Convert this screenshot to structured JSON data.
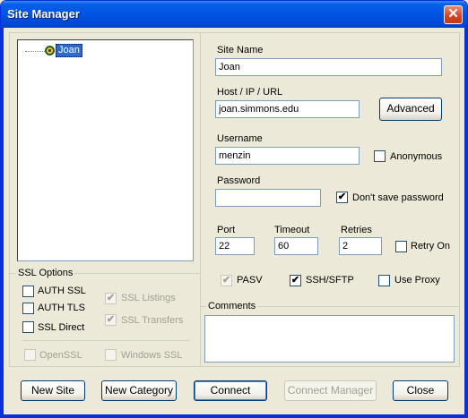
{
  "window": {
    "title": "Site Manager"
  },
  "tree": {
    "items": [
      {
        "label": "Joan"
      }
    ]
  },
  "ssl_options": {
    "label": "SSL Options",
    "auth_ssl": {
      "label": "AUTH SSL",
      "checked": false
    },
    "auth_tls": {
      "label": "AUTH TLS",
      "checked": false
    },
    "ssl_direct": {
      "label": "SSL Direct",
      "checked": false
    },
    "ssl_listings": {
      "label": "SSL Listings",
      "checked": true,
      "enabled": false
    },
    "ssl_transfers": {
      "label": "SSL Transfers",
      "checked": true,
      "enabled": false
    },
    "openssl": {
      "label": "OpenSSL",
      "checked": false,
      "enabled": false
    },
    "windows_ssl": {
      "label": "Windows SSL",
      "checked": false,
      "enabled": false
    }
  },
  "site": {
    "site_name_label": "Site Name",
    "site_name_value": "Joan",
    "host_label": "Host / IP / URL",
    "host_value": "joan.simmons.edu",
    "advanced_button": "Advanced",
    "username_label": "Username",
    "username_value": "menzin",
    "anonymous_label": "Anonymous",
    "anonymous_checked": false,
    "password_label": "Password",
    "password_value": "",
    "dont_save_password_label": "Don't save password",
    "dont_save_password_checked": true,
    "port_label": "Port",
    "port_value": "22",
    "timeout_label": "Timeout",
    "timeout_value": "60",
    "retries_label": "Retries",
    "retries_value": "2",
    "retry_on_label": "Retry On",
    "retry_on_checked": false,
    "pasv_label": "PASV",
    "pasv_checked": true,
    "pasv_enabled": false,
    "ssh_sftp_label": "SSH/SFTP",
    "ssh_sftp_checked": true,
    "use_proxy_label": "Use Proxy",
    "use_proxy_checked": false,
    "comments_label": "Comments",
    "comments_value": ""
  },
  "buttons": {
    "new_site": "New Site",
    "new_category": "New Category",
    "connect": "Connect",
    "connect_manager": "Connect Manager",
    "close": "Close"
  },
  "colors": {
    "title_bar": "#0054e3",
    "dialog_bg": "#ece9d8",
    "selection": "#316ac5"
  }
}
